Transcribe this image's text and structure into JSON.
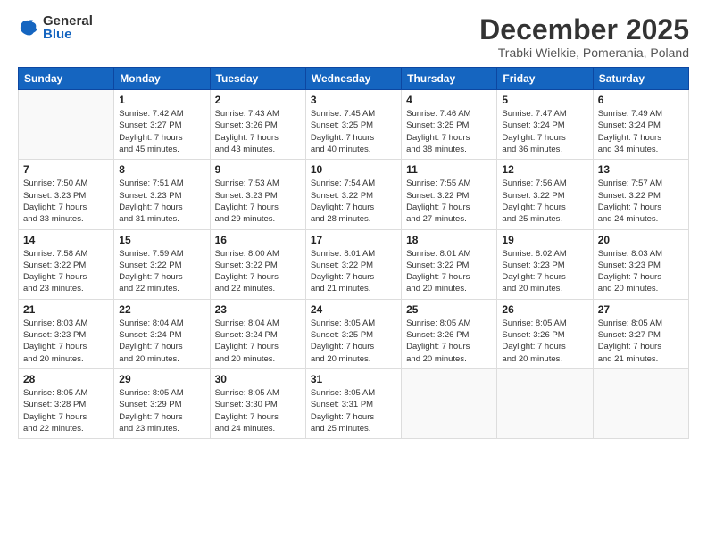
{
  "logo": {
    "general": "General",
    "blue": "Blue"
  },
  "title": "December 2025",
  "subtitle": "Trabki Wielkie, Pomerania, Poland",
  "headers": [
    "Sunday",
    "Monday",
    "Tuesday",
    "Wednesday",
    "Thursday",
    "Friday",
    "Saturday"
  ],
  "weeks": [
    [
      {
        "day": "",
        "info": ""
      },
      {
        "day": "1",
        "info": "Sunrise: 7:42 AM\nSunset: 3:27 PM\nDaylight: 7 hours\nand 45 minutes."
      },
      {
        "day": "2",
        "info": "Sunrise: 7:43 AM\nSunset: 3:26 PM\nDaylight: 7 hours\nand 43 minutes."
      },
      {
        "day": "3",
        "info": "Sunrise: 7:45 AM\nSunset: 3:25 PM\nDaylight: 7 hours\nand 40 minutes."
      },
      {
        "day": "4",
        "info": "Sunrise: 7:46 AM\nSunset: 3:25 PM\nDaylight: 7 hours\nand 38 minutes."
      },
      {
        "day": "5",
        "info": "Sunrise: 7:47 AM\nSunset: 3:24 PM\nDaylight: 7 hours\nand 36 minutes."
      },
      {
        "day": "6",
        "info": "Sunrise: 7:49 AM\nSunset: 3:24 PM\nDaylight: 7 hours\nand 34 minutes."
      }
    ],
    [
      {
        "day": "7",
        "info": "Sunrise: 7:50 AM\nSunset: 3:23 PM\nDaylight: 7 hours\nand 33 minutes."
      },
      {
        "day": "8",
        "info": "Sunrise: 7:51 AM\nSunset: 3:23 PM\nDaylight: 7 hours\nand 31 minutes."
      },
      {
        "day": "9",
        "info": "Sunrise: 7:53 AM\nSunset: 3:23 PM\nDaylight: 7 hours\nand 29 minutes."
      },
      {
        "day": "10",
        "info": "Sunrise: 7:54 AM\nSunset: 3:22 PM\nDaylight: 7 hours\nand 28 minutes."
      },
      {
        "day": "11",
        "info": "Sunrise: 7:55 AM\nSunset: 3:22 PM\nDaylight: 7 hours\nand 27 minutes."
      },
      {
        "day": "12",
        "info": "Sunrise: 7:56 AM\nSunset: 3:22 PM\nDaylight: 7 hours\nand 25 minutes."
      },
      {
        "day": "13",
        "info": "Sunrise: 7:57 AM\nSunset: 3:22 PM\nDaylight: 7 hours\nand 24 minutes."
      }
    ],
    [
      {
        "day": "14",
        "info": "Sunrise: 7:58 AM\nSunset: 3:22 PM\nDaylight: 7 hours\nand 23 minutes."
      },
      {
        "day": "15",
        "info": "Sunrise: 7:59 AM\nSunset: 3:22 PM\nDaylight: 7 hours\nand 22 minutes."
      },
      {
        "day": "16",
        "info": "Sunrise: 8:00 AM\nSunset: 3:22 PM\nDaylight: 7 hours\nand 22 minutes."
      },
      {
        "day": "17",
        "info": "Sunrise: 8:01 AM\nSunset: 3:22 PM\nDaylight: 7 hours\nand 21 minutes."
      },
      {
        "day": "18",
        "info": "Sunrise: 8:01 AM\nSunset: 3:22 PM\nDaylight: 7 hours\nand 20 minutes."
      },
      {
        "day": "19",
        "info": "Sunrise: 8:02 AM\nSunset: 3:23 PM\nDaylight: 7 hours\nand 20 minutes."
      },
      {
        "day": "20",
        "info": "Sunrise: 8:03 AM\nSunset: 3:23 PM\nDaylight: 7 hours\nand 20 minutes."
      }
    ],
    [
      {
        "day": "21",
        "info": "Sunrise: 8:03 AM\nSunset: 3:23 PM\nDaylight: 7 hours\nand 20 minutes."
      },
      {
        "day": "22",
        "info": "Sunrise: 8:04 AM\nSunset: 3:24 PM\nDaylight: 7 hours\nand 20 minutes."
      },
      {
        "day": "23",
        "info": "Sunrise: 8:04 AM\nSunset: 3:24 PM\nDaylight: 7 hours\nand 20 minutes."
      },
      {
        "day": "24",
        "info": "Sunrise: 8:05 AM\nSunset: 3:25 PM\nDaylight: 7 hours\nand 20 minutes."
      },
      {
        "day": "25",
        "info": "Sunrise: 8:05 AM\nSunset: 3:26 PM\nDaylight: 7 hours\nand 20 minutes."
      },
      {
        "day": "26",
        "info": "Sunrise: 8:05 AM\nSunset: 3:26 PM\nDaylight: 7 hours\nand 20 minutes."
      },
      {
        "day": "27",
        "info": "Sunrise: 8:05 AM\nSunset: 3:27 PM\nDaylight: 7 hours\nand 21 minutes."
      }
    ],
    [
      {
        "day": "28",
        "info": "Sunrise: 8:05 AM\nSunset: 3:28 PM\nDaylight: 7 hours\nand 22 minutes."
      },
      {
        "day": "29",
        "info": "Sunrise: 8:05 AM\nSunset: 3:29 PM\nDaylight: 7 hours\nand 23 minutes."
      },
      {
        "day": "30",
        "info": "Sunrise: 8:05 AM\nSunset: 3:30 PM\nDaylight: 7 hours\nand 24 minutes."
      },
      {
        "day": "31",
        "info": "Sunrise: 8:05 AM\nSunset: 3:31 PM\nDaylight: 7 hours\nand 25 minutes."
      },
      {
        "day": "",
        "info": ""
      },
      {
        "day": "",
        "info": ""
      },
      {
        "day": "",
        "info": ""
      }
    ]
  ]
}
